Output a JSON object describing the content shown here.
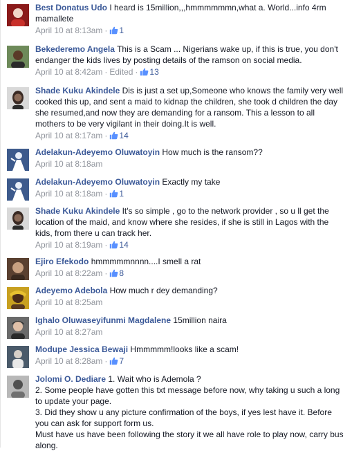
{
  "comments": [
    {
      "name": "Best Donatus Udo",
      "text": "I heard is 15million,,,hmmmmmmn,what a. World...info 4rm mamallete",
      "time": "April 10 at 8:13am",
      "edited": "",
      "likes": "1",
      "avatar": {
        "bg": "#8a1a1a",
        "fg": "#f0d6c8"
      }
    },
    {
      "name": "Bekederemo Angela",
      "text": "This is a Scam ... Nigerians wake up, if this is true, you don't endanger the kids lives by posting details of the ramson on social media.",
      "time": "April 10 at 8:42am",
      "edited": "Edited",
      "likes": "13",
      "avatar": {
        "bg": "#6e8a5a",
        "fg": "#5a3a28"
      }
    },
    {
      "name": "Shade Kuku Akindele",
      "text": "Dis is just a set up,Someone who knows the family very well cooked this up, and sent a maid to kidnap the children, she took d children the day she resumed,and now they are demanding for a ransom. This a lesson to all mothers to be very vigilant in their doing.It is well.",
      "time": "April 10 at 8:17am",
      "edited": "",
      "likes": "14",
      "avatar": {
        "bg": "#d9d9d9",
        "fg": "#3a2a24"
      }
    },
    {
      "name": "Adelakun-Adeyemo Oluwatoyin",
      "text": "How much is the ransom??",
      "time": "April 10 at 8:18am",
      "edited": "",
      "likes": "",
      "avatar": {
        "bg": "#3d5a8c",
        "fg": "#e8eef8"
      }
    },
    {
      "name": "Adelakun-Adeyemo Oluwatoyin",
      "text": "Exactly my take",
      "time": "April 10 at 8:18am",
      "edited": "",
      "likes": "1",
      "avatar": {
        "bg": "#3d5a8c",
        "fg": "#e8eef8"
      }
    },
    {
      "name": "Shade Kuku Akindele",
      "text": "It's so simple , go to the network provider , so u ll get the location of the maid, and know where she resides, if she is still in Lagos with the kids, from there u can track her.",
      "time": "April 10 at 8:19am",
      "edited": "",
      "likes": "14",
      "avatar": {
        "bg": "#d9d9d9",
        "fg": "#3a2a24"
      }
    },
    {
      "name": "Ejiro Efekodo",
      "text": "hmmmmmnnnn....I smell a rat",
      "time": "April 10 at 8:22am",
      "edited": "",
      "likes": "8",
      "avatar": {
        "bg": "#5a4030",
        "fg": "#c8a080"
      }
    },
    {
      "name": "Adeyemo Adebola",
      "text": "How much r dey demanding?",
      "time": "April 10 at 8:25am",
      "edited": "",
      "likes": "",
      "avatar": {
        "bg": "#c8a020",
        "fg": "#4a2a18"
      }
    },
    {
      "name": "Ighalo Oluwaseyifunmi Magdalene",
      "text": "15million naira",
      "time": "April 10 at 8:27am",
      "edited": "",
      "likes": "",
      "avatar": {
        "bg": "#6a6a6a",
        "fg": "#e0c0a8"
      }
    },
    {
      "name": "Modupe Jessica Bewaji",
      "text": "Hmmmmm!looks like a scam!",
      "time": "April 10 at 8:28am",
      "edited": "",
      "likes": "7",
      "avatar": {
        "bg": "#4a5a6a",
        "fg": "#d8d0c8"
      }
    },
    {
      "name": "Jolomi O. Dediare",
      "text": "1. Wait who is Ademola ?",
      "time": "",
      "edited": "",
      "likes": "",
      "avatar": {
        "bg": "#b8b8b8",
        "fg": "#505050"
      },
      "extra_lines": [
        "2. Some people have gotten this txt message before now, why taking u such a long to update your page.",
        "3. Did they show u any picture confirmation of the boys, if yes lest have it. Before you can ask for support form us.",
        "Must have us have been following the story it we all have role to play now, carry bus along."
      ]
    }
  ],
  "colors": {
    "name": "#3b5998",
    "meta": "#90949c",
    "text": "#141823"
  },
  "icons": {
    "like": "thumbs-up-icon",
    "dot": "·"
  }
}
